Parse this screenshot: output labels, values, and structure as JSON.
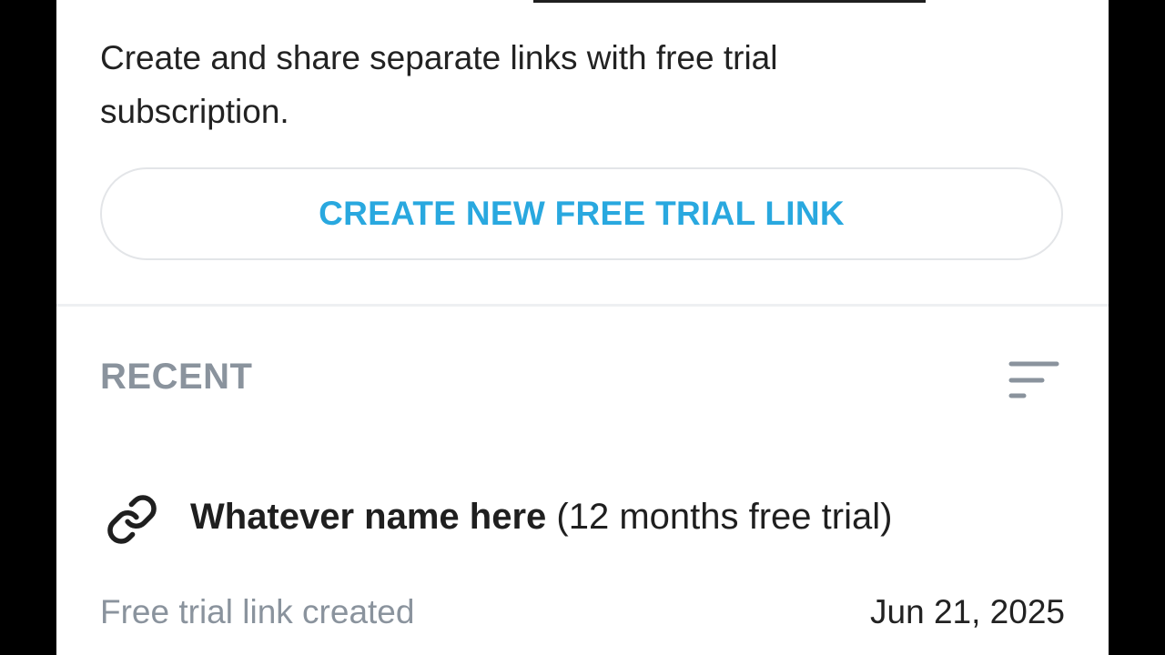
{
  "description": "Create and share separate links with free trial subscription.",
  "create_button_label": "CREATE NEW FREE TRIAL LINK",
  "recent": {
    "header": "RECENT",
    "sort_icon": "sort-lines-icon"
  },
  "items": [
    {
      "icon": "link-icon",
      "name": "Whatever name here",
      "detail": "(12 months free trial)",
      "subtitle": "Free trial link created",
      "date": "Jun 21, 2025"
    }
  ],
  "colors": {
    "accent": "#29a8df",
    "secondary_text": "#8a939d",
    "primary_text": "#1f1f1f",
    "background": "#ffffff",
    "frame": "#000000"
  }
}
